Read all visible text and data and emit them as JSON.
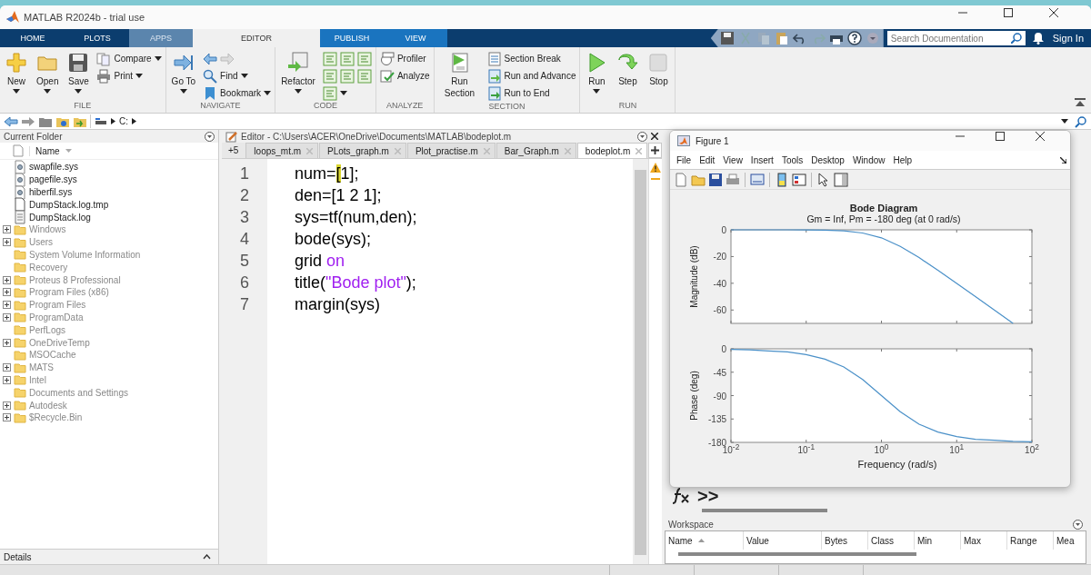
{
  "window": {
    "title": "MATLAB R2024b - trial use"
  },
  "tabs": [
    {
      "label": "HOME",
      "selected": false,
      "kind": "plain"
    },
    {
      "label": "PLOTS",
      "selected": false,
      "kind": "plain"
    },
    {
      "label": "APPS",
      "selected": false,
      "kind": "muted"
    },
    {
      "label": "EDITOR",
      "selected": true,
      "kind": "plain"
    },
    {
      "label": "PUBLISH",
      "selected": false,
      "kind": "context"
    },
    {
      "label": "VIEW",
      "selected": false,
      "kind": "context"
    }
  ],
  "search": {
    "placeholder": "Search Documentation"
  },
  "sign_in": "Sign In",
  "ribbon": [
    {
      "label": "FILE",
      "columns": [
        {
          "kind": "large",
          "label": "New",
          "dropdown": true
        },
        {
          "kind": "large",
          "label": "Open",
          "dropdown": true
        },
        {
          "kind": "large",
          "label": "Save",
          "dropdown": true
        },
        {
          "kind": "stack",
          "rows": [
            [
              {
                "label": "Compare",
                "dropdown": true
              }
            ],
            [
              {
                "label": "Print",
                "dropdown": true
              }
            ]
          ]
        }
      ]
    },
    {
      "label": "NAVIGATE",
      "columns": [
        {
          "kind": "large",
          "label": "Go To",
          "dropdown": true
        },
        {
          "kind": "stack",
          "rows": [
            [
              {
                "dropdown": false
              },
              {
                "dropdown": false
              }
            ],
            [
              {
                "label": "Find",
                "dropdown": true
              }
            ],
            [
              {
                "label": "Bookmark",
                "dropdown": true
              }
            ]
          ]
        }
      ]
    },
    {
      "label": "CODE",
      "columns": [
        {
          "kind": "large",
          "label": "Refactor",
          "dropdown": true
        },
        {
          "kind": "stack",
          "rows": [
            [
              {
                "dropdown": false
              },
              {
                "dropdown": false
              },
              {
                "dropdown": false
              }
            ],
            [
              {
                "dropdown": false
              },
              {
                "dropdown": false
              },
              {
                "dropdown": false
              }
            ],
            [
              {
                "dropdown": true
              }
            ]
          ]
        }
      ]
    },
    {
      "label": "ANALYZE",
      "columns": [
        {
          "kind": "stack",
          "rows": [
            [
              {
                "label": "Profiler",
                "dropdown": false
              }
            ],
            [
              {
                "label": "Analyze",
                "dropdown": false
              }
            ]
          ]
        }
      ]
    },
    {
      "label": "SECTION",
      "columns": [
        {
          "kind": "large",
          "label": "Run Section",
          "dropdown": false
        },
        {
          "kind": "stack",
          "rows": [
            [
              {
                "label": "Section Break",
                "dropdown": false
              }
            ],
            [
              {
                "label": "Run and Advance",
                "dropdown": false
              }
            ],
            [
              {
                "label": "Run to End",
                "dropdown": false
              }
            ]
          ]
        }
      ]
    },
    {
      "label": "RUN",
      "columns": [
        {
          "kind": "large",
          "label": "Run",
          "dropdown": true
        },
        {
          "kind": "large",
          "label": "Step",
          "dropdown": false
        },
        {
          "kind": "large",
          "label": "Stop",
          "dropdown": false
        }
      ]
    }
  ],
  "address_bar": {
    "path": [
      "C:"
    ]
  },
  "current_folder": {
    "title": "Current Folder",
    "column": "Name",
    "details": "Details",
    "items": [
      {
        "name": "swapfile.sys",
        "kind": "sysfile",
        "expandable": false,
        "hidden": false
      },
      {
        "name": "pagefile.sys",
        "kind": "sysfile",
        "expandable": false,
        "hidden": false
      },
      {
        "name": "hiberfil.sys",
        "kind": "sysfile",
        "expandable": false,
        "hidden": false
      },
      {
        "name": "DumpStack.log.tmp",
        "kind": "file",
        "expandable": false,
        "hidden": false
      },
      {
        "name": "DumpStack.log",
        "kind": "log",
        "expandable": false,
        "hidden": false
      },
      {
        "name": "Windows",
        "kind": "folder",
        "expandable": true,
        "hidden": true
      },
      {
        "name": "Users",
        "kind": "folder",
        "expandable": true,
        "hidden": true
      },
      {
        "name": "System Volume Information",
        "kind": "folder",
        "expandable": false,
        "hidden": true
      },
      {
        "name": "Recovery",
        "kind": "folder",
        "expandable": false,
        "hidden": true
      },
      {
        "name": "Proteus 8 Professional",
        "kind": "folder",
        "expandable": true,
        "hidden": true
      },
      {
        "name": "Program Files (x86)",
        "kind": "folder",
        "expandable": true,
        "hidden": true
      },
      {
        "name": "Program Files",
        "kind": "folder",
        "expandable": true,
        "hidden": true
      },
      {
        "name": "ProgramData",
        "kind": "folder",
        "expandable": true,
        "hidden": true
      },
      {
        "name": "PerfLogs",
        "kind": "folder",
        "expandable": false,
        "hidden": true
      },
      {
        "name": "OneDriveTemp",
        "kind": "folder",
        "expandable": true,
        "hidden": true
      },
      {
        "name": "MSOCache",
        "kind": "folder",
        "expandable": false,
        "hidden": true
      },
      {
        "name": "MATS",
        "kind": "folder",
        "expandable": true,
        "hidden": true
      },
      {
        "name": "Intel",
        "kind": "folder",
        "expandable": true,
        "hidden": true
      },
      {
        "name": "Documents and Settings",
        "kind": "folder",
        "expandable": false,
        "hidden": true
      },
      {
        "name": "Autodesk",
        "kind": "folder",
        "expandable": true,
        "hidden": true
      },
      {
        "name": "$Recycle.Bin",
        "kind": "folder",
        "expandable": true,
        "hidden": true
      }
    ]
  },
  "editor": {
    "title": "Editor - C:\\Users\\ACER\\OneDrive\\Documents\\MATLAB\\bodeplot.m",
    "overflow": "+5",
    "tabs": [
      {
        "label": "loops_mt.m",
        "selected": false
      },
      {
        "label": "PLots_graph.m",
        "selected": false
      },
      {
        "label": "Plot_practise.m",
        "selected": false
      },
      {
        "label": "Bar_Graph.m",
        "selected": false
      },
      {
        "label": "bodeplot.m",
        "selected": true
      }
    ],
    "lines": [
      {
        "number": "1",
        "tokens": [
          {
            "text": "num=",
            "kind": "plain"
          },
          {
            "text": "[",
            "kind": "match"
          },
          {
            "text": "1];",
            "kind": "plain"
          }
        ]
      },
      {
        "number": "2",
        "tokens": [
          {
            "text": "den=[1 2 1];",
            "kind": "plain"
          }
        ]
      },
      {
        "number": "3",
        "tokens": [
          {
            "text": "sys=tf(num,den);",
            "kind": "plain"
          }
        ]
      },
      {
        "number": "4",
        "tokens": [
          {
            "text": "bode(sys);",
            "kind": "plain"
          }
        ]
      },
      {
        "number": "5",
        "tokens": [
          {
            "text": "grid ",
            "kind": "plain"
          },
          {
            "text": "on",
            "kind": "string"
          }
        ]
      },
      {
        "number": "6",
        "tokens": [
          {
            "text": "title(",
            "kind": "plain"
          },
          {
            "text": "\"Bode plot\"",
            "kind": "string"
          },
          {
            "text": ");",
            "kind": "plain"
          }
        ]
      },
      {
        "number": "7",
        "tokens": [
          {
            "text": "margin(sys)",
            "kind": "plain"
          }
        ]
      }
    ]
  },
  "figure": {
    "title": "Figure 1",
    "menu": [
      "File",
      "Edit",
      "View",
      "Insert",
      "Tools",
      "Desktop",
      "Window",
      "Help"
    ],
    "plot_title": "Bode Diagram",
    "plot_subtitle": "Gm = Inf,  Pm = -180 deg (at 0 rad/s)",
    "magnitude_plot": {
      "chart_data": {
        "type": "line",
        "ylabel": "Magnitude (dB)",
        "categories": [
          null,
          null,
          null,
          null,
          null,
          null,
          null,
          null,
          null,
          null,
          null,
          null,
          null,
          null,
          null,
          null,
          null
        ],
        "series": [
          {
            "color": "#4a90c8",
            "values": [
              0,
              0,
              0,
              0,
              -0.1,
              -0.3,
              -0.8,
              -2.4,
              -6.0,
              -12.4,
              -20.8,
              -30.3,
              -40.1,
              -50.0,
              -60.0,
              -70.0,
              null
            ]
          }
        ],
        "ylim": [
          -70,
          0
        ],
        "yticks": [
          0,
          -20,
          -40,
          -60
        ]
      }
    },
    "phase_plot": {
      "chart_data": {
        "type": "line",
        "ylabel": "Phase (deg)",
        "xlabel": "Frequency (rad/s)",
        "categories": [
          "10$^{-2}$",
          null,
          null,
          null,
          "10$^{-1}$",
          null,
          null,
          null,
          "10$^{0}$",
          null,
          null,
          null,
          "10$^{1}$",
          null,
          null,
          null,
          "10$^{2}$"
        ],
        "series": [
          {
            "color": "#4a90c8",
            "values": [
              -1,
              -2,
              -4,
              -6,
              -11,
              -20,
              -35,
              -59,
              -90,
              -121,
              -145,
              -160,
              -169,
              -174,
              -176,
              -178,
              -179
            ]
          }
        ],
        "ylim": [
          -180,
          0
        ],
        "yticks": [
          0,
          -45,
          -90,
          -135,
          -180
        ]
      }
    }
  },
  "command_window": {
    "prompt": ">>"
  },
  "workspace": {
    "title": "Workspace",
    "columns": [
      {
        "label": "Name",
        "sorted": true
      },
      {
        "label": "Value",
        "sorted": false
      },
      {
        "label": "Bytes",
        "sorted": false
      },
      {
        "label": "Class",
        "sorted": false
      },
      {
        "label": "Min",
        "sorted": false
      },
      {
        "label": "Max",
        "sorted": false
      },
      {
        "label": "Range",
        "sorted": false
      },
      {
        "label": "Mea",
        "sorted": false
      }
    ]
  }
}
